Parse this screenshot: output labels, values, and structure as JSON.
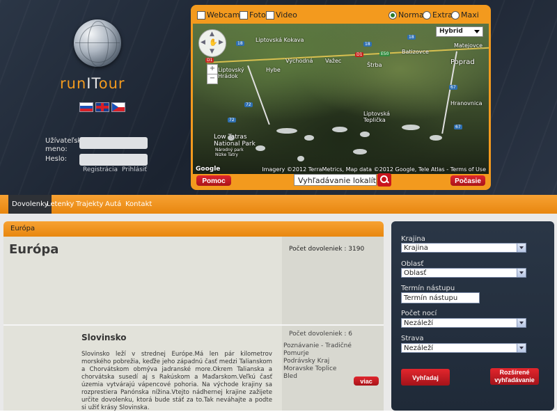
{
  "brand": {
    "part1": "run",
    "part2": "IT",
    "part3": "our"
  },
  "languages": [
    "slovak-flag",
    "uk-flag",
    "czech-flag"
  ],
  "login": {
    "username_label_1": "Užívateľské",
    "username_label_2": "meno:",
    "password_label": "Heslo:",
    "register_link": "Registrácia",
    "login_link": "Prihlásiť"
  },
  "map_options": {
    "webcams": "Webcams",
    "photo": "Foto",
    "video": "Video",
    "normal": "Normal",
    "extra": "Extra",
    "maxi": "Maxi",
    "selected": "Normal"
  },
  "map": {
    "type_select": "Hybrid",
    "towns": [
      "Liptovská Kokava",
      "Východná",
      "Važec",
      "Batizovce",
      "Poprad",
      "Liptovský Hrádok",
      "Hybe",
      "Štrba",
      "Liptovská Teplička",
      "Hranovnica",
      "Low Tatras National Park",
      "Národný park Nízke Tatry",
      "Matejovce"
    ],
    "roads": [
      "D1",
      "D1",
      "E50",
      "18",
      "18",
      "67",
      "67",
      "72",
      "72",
      "18"
    ],
    "attribution": "Imagery ©2012 TerraMetrics, Map data ©2012 Google, Tele Atlas - Terms of Use",
    "google_logo": "Google",
    "help_button": "Pomoc",
    "location_search_placeholder": "Vyhľadávanie lokalít",
    "weather_button": "Počasie"
  },
  "menu": [
    {
      "label": "Dovolenky",
      "active": true
    },
    {
      "label": "Letenky"
    },
    {
      "label": "Trajekty"
    },
    {
      "label": "Autá"
    },
    {
      "label": "Kontakt"
    }
  ],
  "card": {
    "header": "Európa",
    "title": "Európa",
    "count_label": "Počet dovoleniek : 3190",
    "sk_title": "Slovinsko",
    "sk_desc": "Slovinsko leží v strednej Európe.Má len pár kilometrov morského pobrežia, keďže jeho západnú časť medzi Talianskom a Chorvátskom obmýva jadranské more.Okrem Talianska a chorvátska susedí aj s Rakúskom a Maďarskom.Veľkú časť územia vytvárajú vápencové pohoria. Na východe krajiny sa rozprestiera Panónska nížina.Vtejto nádhernej krajine zažijete určite dovolenku, ktorá bude stáť za to.Tak neváhajte a podte si užiť krásy Slovinska.",
    "sk_count_label": "Počet dovoleniek : 6",
    "sk_places": [
      "Poznávanie - Tradičné",
      "Pomurje",
      "Podrávsky Kraj",
      "Moravske Toplice",
      "Bled"
    ],
    "more_button": "viac"
  },
  "search": {
    "country_label": "Krajina",
    "country_value": "Krajina",
    "region_label": "Oblasť",
    "region_value": "Oblasť",
    "date_label": "Termín nástupu",
    "date_value": "Termín nástupu",
    "nights_label": "Počet nocí",
    "nights_value": "Nezáleží",
    "board_label": "Strava",
    "board_value": "Nezáleží",
    "search_button": "Vyhľadaj",
    "advanced_button_1": "Rozšírené",
    "advanced_button_2": "vyhľadávanie"
  }
}
